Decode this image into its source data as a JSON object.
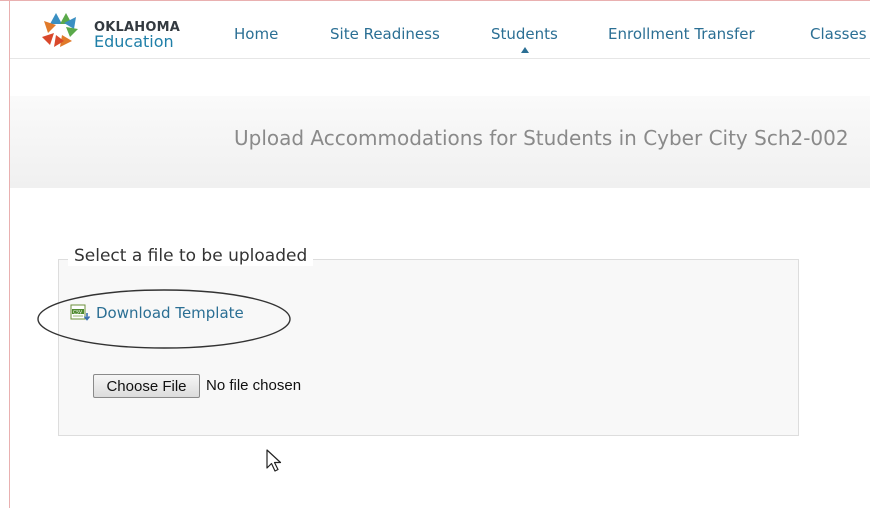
{
  "brand": {
    "line1": "OKLAHOMA",
    "line2": "Education"
  },
  "nav": {
    "items": [
      "Home",
      "Site Readiness",
      "Students",
      "Enrollment Transfer",
      "Classes"
    ],
    "active": "Students"
  },
  "page": {
    "title": "Upload Accommodations for Students in Cyber City Sch2-002"
  },
  "upload": {
    "legend": "Select a file to be uploaded",
    "download_label": "Download Template",
    "choose_button": "Choose File",
    "file_status": "No file chosen"
  },
  "icons": {
    "download": "csv-file-icon",
    "cursor": "mouse-pointer-icon"
  },
  "colors": {
    "link": "#2b6f94",
    "title": "#8a8a8a",
    "logo_blue": "#1f7fa8"
  }
}
